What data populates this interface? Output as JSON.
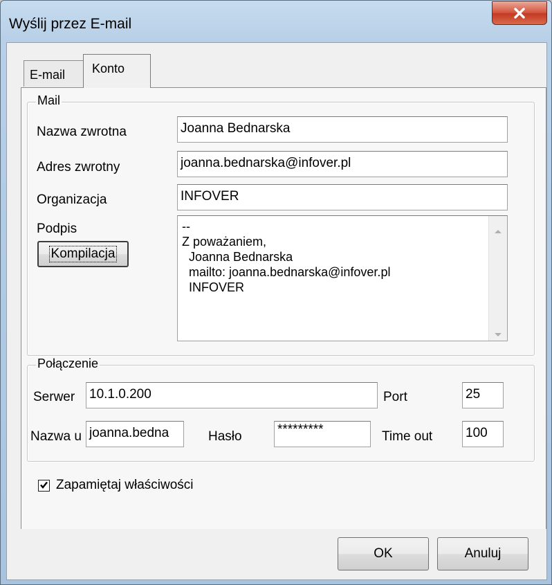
{
  "window": {
    "title": "Wyślij przez E-mail",
    "close_icon": "close-icon"
  },
  "tabs": [
    {
      "label": "E-mail",
      "active": false
    },
    {
      "label": "Konto",
      "active": true
    }
  ],
  "mail_group": {
    "legend": "Mail",
    "return_name_label": "Nazwa zwrotna",
    "return_name_value": "Joanna Bednarska",
    "return_address_label": "Adres zwrotny",
    "return_address_value": "joanna.bednarska@infover.pl",
    "organization_label": "Organizacja",
    "organization_value": "INFOVER",
    "signature_label": "Podpis",
    "compile_button": "Kompilacja",
    "signature_lines": [
      "--",
      "Z poważaniem,",
      "  Joanna Bednarska",
      "  mailto: joanna.bednarska@infover.pl",
      "  INFOVER"
    ]
  },
  "connection_group": {
    "legend": "Połączenie",
    "server_label": "Serwer",
    "server_value": "10.1.0.200",
    "port_label": "Port",
    "port_value": "25",
    "username_label": "Nazwa u",
    "username_value": "joanna.bedna",
    "password_label": "Hasło",
    "password_value": "*********",
    "timeout_label": "Time out",
    "timeout_value": "100"
  },
  "remember": {
    "label": "Zapamiętaj właściwości",
    "checked": true
  },
  "buttons": {
    "ok": "OK",
    "cancel": "Anuluj"
  },
  "colors": {
    "title_bar": "#b7cfe7",
    "close_button": "#c23a22",
    "dialog_face": "#f0f0f0"
  }
}
